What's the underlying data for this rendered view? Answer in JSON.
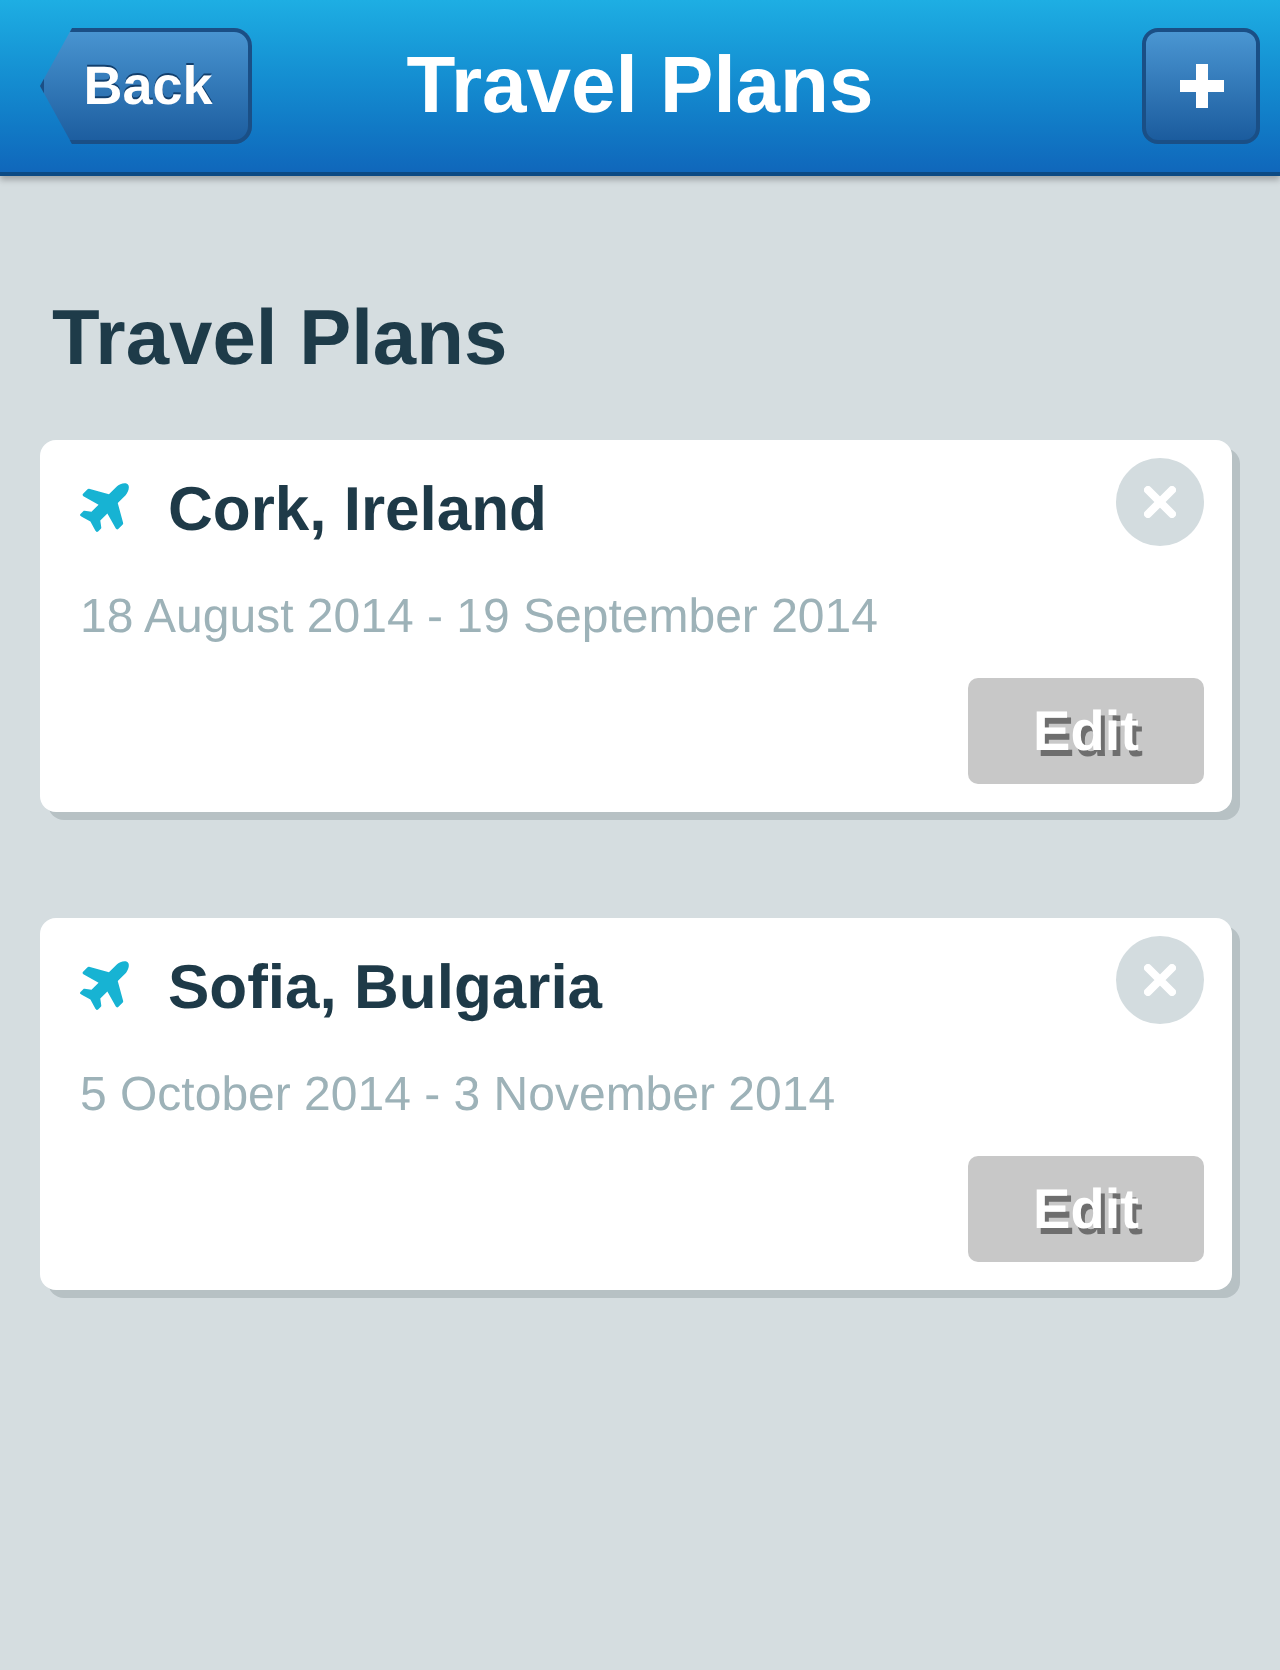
{
  "nav_bar": {
    "back_button": "Back",
    "title": "Travel Plans"
  },
  "heading": "Travel Plans",
  "trips": [
    {
      "destination": "Cork, Ireland",
      "dates": "18 August 2014 - 19 September 2014",
      "edit_button": "Edit"
    },
    {
      "destination": "Sofia, Bulgaria",
      "dates": "5 October 2014 - 3 November 2014",
      "edit_button": "Edit"
    }
  ]
}
